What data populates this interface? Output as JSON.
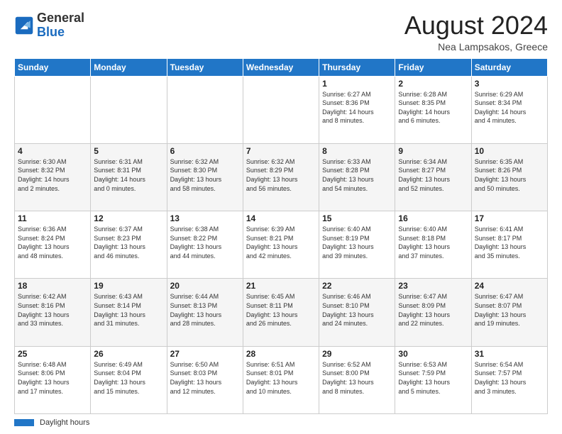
{
  "header": {
    "logo": {
      "general": "General",
      "blue": "Blue"
    },
    "month_year": "August 2024",
    "location": "Nea Lampsakos, Greece"
  },
  "days_of_week": [
    "Sunday",
    "Monday",
    "Tuesday",
    "Wednesday",
    "Thursday",
    "Friday",
    "Saturday"
  ],
  "weeks": [
    [
      {
        "day": "",
        "detail": ""
      },
      {
        "day": "",
        "detail": ""
      },
      {
        "day": "",
        "detail": ""
      },
      {
        "day": "",
        "detail": ""
      },
      {
        "day": "1",
        "detail": "Sunrise: 6:27 AM\nSunset: 8:36 PM\nDaylight: 14 hours\nand 8 minutes."
      },
      {
        "day": "2",
        "detail": "Sunrise: 6:28 AM\nSunset: 8:35 PM\nDaylight: 14 hours\nand 6 minutes."
      },
      {
        "day": "3",
        "detail": "Sunrise: 6:29 AM\nSunset: 8:34 PM\nDaylight: 14 hours\nand 4 minutes."
      }
    ],
    [
      {
        "day": "4",
        "detail": "Sunrise: 6:30 AM\nSunset: 8:32 PM\nDaylight: 14 hours\nand 2 minutes."
      },
      {
        "day": "5",
        "detail": "Sunrise: 6:31 AM\nSunset: 8:31 PM\nDaylight: 14 hours\nand 0 minutes."
      },
      {
        "day": "6",
        "detail": "Sunrise: 6:32 AM\nSunset: 8:30 PM\nDaylight: 13 hours\nand 58 minutes."
      },
      {
        "day": "7",
        "detail": "Sunrise: 6:32 AM\nSunset: 8:29 PM\nDaylight: 13 hours\nand 56 minutes."
      },
      {
        "day": "8",
        "detail": "Sunrise: 6:33 AM\nSunset: 8:28 PM\nDaylight: 13 hours\nand 54 minutes."
      },
      {
        "day": "9",
        "detail": "Sunrise: 6:34 AM\nSunset: 8:27 PM\nDaylight: 13 hours\nand 52 minutes."
      },
      {
        "day": "10",
        "detail": "Sunrise: 6:35 AM\nSunset: 8:26 PM\nDaylight: 13 hours\nand 50 minutes."
      }
    ],
    [
      {
        "day": "11",
        "detail": "Sunrise: 6:36 AM\nSunset: 8:24 PM\nDaylight: 13 hours\nand 48 minutes."
      },
      {
        "day": "12",
        "detail": "Sunrise: 6:37 AM\nSunset: 8:23 PM\nDaylight: 13 hours\nand 46 minutes."
      },
      {
        "day": "13",
        "detail": "Sunrise: 6:38 AM\nSunset: 8:22 PM\nDaylight: 13 hours\nand 44 minutes."
      },
      {
        "day": "14",
        "detail": "Sunrise: 6:39 AM\nSunset: 8:21 PM\nDaylight: 13 hours\nand 42 minutes."
      },
      {
        "day": "15",
        "detail": "Sunrise: 6:40 AM\nSunset: 8:19 PM\nDaylight: 13 hours\nand 39 minutes."
      },
      {
        "day": "16",
        "detail": "Sunrise: 6:40 AM\nSunset: 8:18 PM\nDaylight: 13 hours\nand 37 minutes."
      },
      {
        "day": "17",
        "detail": "Sunrise: 6:41 AM\nSunset: 8:17 PM\nDaylight: 13 hours\nand 35 minutes."
      }
    ],
    [
      {
        "day": "18",
        "detail": "Sunrise: 6:42 AM\nSunset: 8:16 PM\nDaylight: 13 hours\nand 33 minutes."
      },
      {
        "day": "19",
        "detail": "Sunrise: 6:43 AM\nSunset: 8:14 PM\nDaylight: 13 hours\nand 31 minutes."
      },
      {
        "day": "20",
        "detail": "Sunrise: 6:44 AM\nSunset: 8:13 PM\nDaylight: 13 hours\nand 28 minutes."
      },
      {
        "day": "21",
        "detail": "Sunrise: 6:45 AM\nSunset: 8:11 PM\nDaylight: 13 hours\nand 26 minutes."
      },
      {
        "day": "22",
        "detail": "Sunrise: 6:46 AM\nSunset: 8:10 PM\nDaylight: 13 hours\nand 24 minutes."
      },
      {
        "day": "23",
        "detail": "Sunrise: 6:47 AM\nSunset: 8:09 PM\nDaylight: 13 hours\nand 22 minutes."
      },
      {
        "day": "24",
        "detail": "Sunrise: 6:47 AM\nSunset: 8:07 PM\nDaylight: 13 hours\nand 19 minutes."
      }
    ],
    [
      {
        "day": "25",
        "detail": "Sunrise: 6:48 AM\nSunset: 8:06 PM\nDaylight: 13 hours\nand 17 minutes."
      },
      {
        "day": "26",
        "detail": "Sunrise: 6:49 AM\nSunset: 8:04 PM\nDaylight: 13 hours\nand 15 minutes."
      },
      {
        "day": "27",
        "detail": "Sunrise: 6:50 AM\nSunset: 8:03 PM\nDaylight: 13 hours\nand 12 minutes."
      },
      {
        "day": "28",
        "detail": "Sunrise: 6:51 AM\nSunset: 8:01 PM\nDaylight: 13 hours\nand 10 minutes."
      },
      {
        "day": "29",
        "detail": "Sunrise: 6:52 AM\nSunset: 8:00 PM\nDaylight: 13 hours\nand 8 minutes."
      },
      {
        "day": "30",
        "detail": "Sunrise: 6:53 AM\nSunset: 7:59 PM\nDaylight: 13 hours\nand 5 minutes."
      },
      {
        "day": "31",
        "detail": "Sunrise: 6:54 AM\nSunset: 7:57 PM\nDaylight: 13 hours\nand 3 minutes."
      }
    ]
  ],
  "legend": {
    "label": "Daylight hours"
  }
}
